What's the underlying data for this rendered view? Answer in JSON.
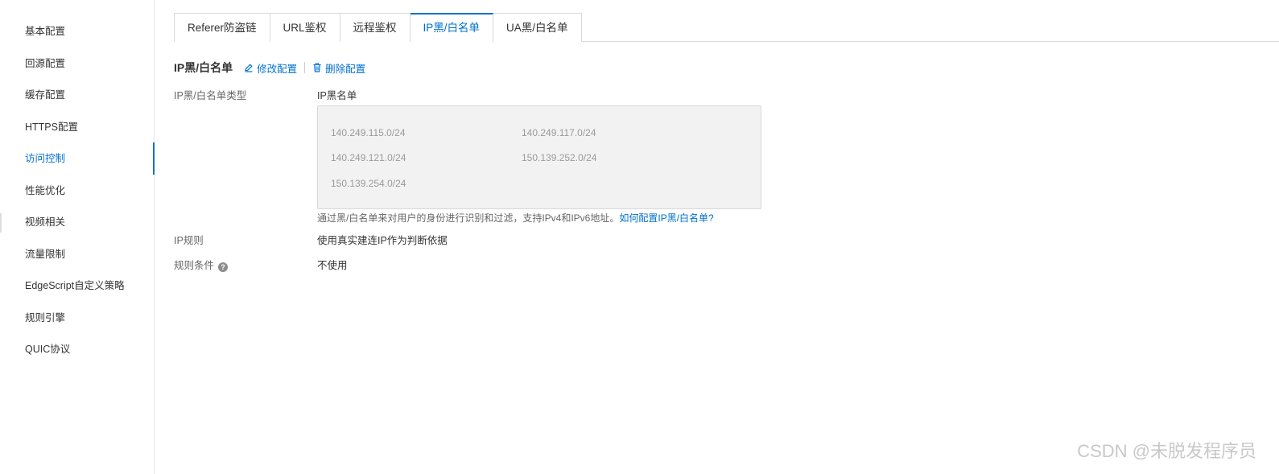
{
  "sidebar": {
    "items": [
      {
        "label": "基本配置"
      },
      {
        "label": "回源配置"
      },
      {
        "label": "缓存配置"
      },
      {
        "label": "HTTPS配置"
      },
      {
        "label": "访问控制",
        "active": true
      },
      {
        "label": "性能优化"
      },
      {
        "label": "视频相关"
      },
      {
        "label": "流量限制"
      },
      {
        "label": "EdgeScript自定义策略"
      },
      {
        "label": "规则引擎"
      },
      {
        "label": "QUIC协议"
      }
    ]
  },
  "tabs": [
    {
      "label": "Referer防盗链"
    },
    {
      "label": "URL鉴权"
    },
    {
      "label": "远程鉴权"
    },
    {
      "label": "IP黑/白名单",
      "active": true
    },
    {
      "label": "UA黑/白名单"
    }
  ],
  "section": {
    "title": "IP黑/白名单",
    "edit_label": "修改配置",
    "delete_label": "删除配置"
  },
  "details": {
    "list_type_label": "IP黑/白名单类型",
    "list_type_value": "IP黑名单",
    "ip_list": [
      "140.249.115.0/24",
      "140.249.117.0/24",
      "140.249.121.0/24",
      "150.139.252.0/24",
      "150.139.254.0/24"
    ],
    "hint_text": "通过黑/白名单来对用户的身份进行识别和过滤，支持IPv4和IPv6地址。",
    "hint_link": "如何配置IP黑/白名单?",
    "ip_rule_label": "IP规则",
    "ip_rule_value": "使用真实建连IP作为判断依据",
    "rule_condition_label": "规则条件",
    "rule_condition_value": "不使用"
  },
  "watermark": "CSDN @未脱发程序员",
  "colors": {
    "accent": "#0070cc",
    "text": "#333333",
    "muted": "#666666",
    "box_bg": "#f2f2f2"
  },
  "icons": {
    "edit": "pencil-icon",
    "delete": "trash-icon",
    "help": "question-circle-icon"
  }
}
